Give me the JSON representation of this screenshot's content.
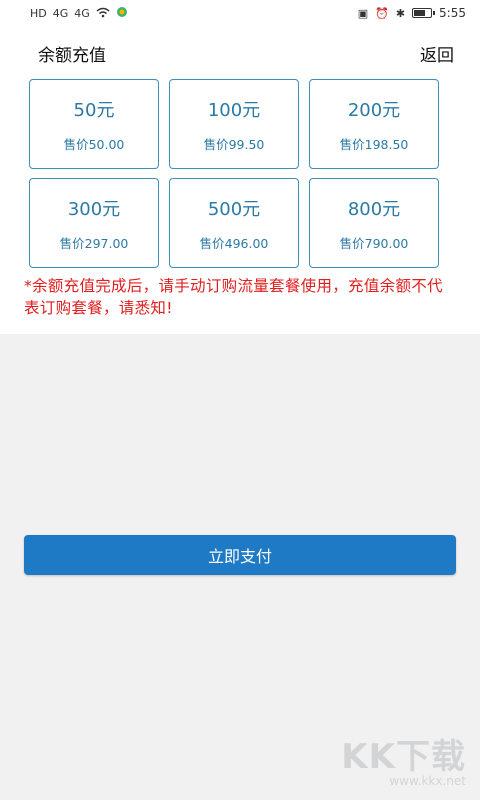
{
  "status_bar": {
    "left_icons": [
      "HD",
      "4G",
      "4G",
      "wifi-icon",
      "app-icon"
    ],
    "time": "5:55"
  },
  "header": {
    "title": "余额充值",
    "back_label": "返回"
  },
  "options": [
    {
      "amount": "50元",
      "price": "售价50.00"
    },
    {
      "amount": "100元",
      "price": "售价99.50"
    },
    {
      "amount": "200元",
      "price": "售价198.50"
    },
    {
      "amount": "300元",
      "price": "售价297.00"
    },
    {
      "amount": "500元",
      "price": "售价496.00"
    },
    {
      "amount": "800元",
      "price": "售价790.00"
    }
  ],
  "notice": "*余额充值完成后，请手动订购流量套餐使用，充值余额不代表订购套餐，请悉知!",
  "pay_button_label": "立即支付",
  "watermark": {
    "logo": "KK下载",
    "url": "www.kkx.net"
  },
  "colors": {
    "accent": "#1f7ac6",
    "card_border": "#3a8fb7",
    "notice": "#e02020",
    "background": "#f1f1f1"
  }
}
